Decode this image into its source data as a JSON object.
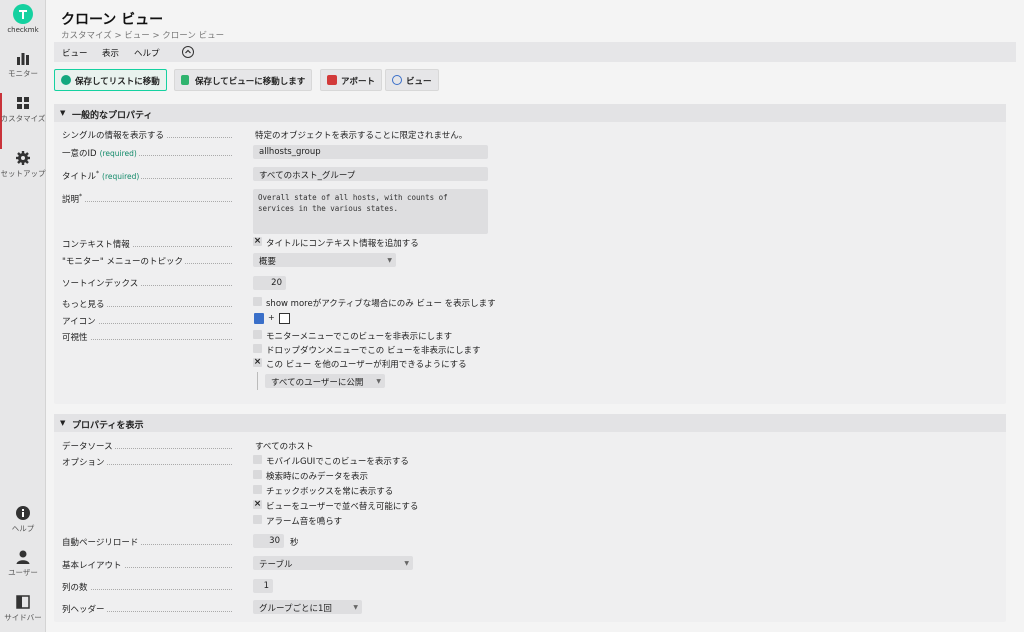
{
  "sidebar": {
    "brand": "checkmk",
    "items": [
      {
        "label": "モニター",
        "icon": "bar-chart-icon"
      },
      {
        "label": "カスタマイズ",
        "icon": "grid-icon"
      },
      {
        "label": "セットアップ",
        "icon": "gear-icon"
      }
    ],
    "bottom_items": [
      {
        "label": "ヘルプ",
        "icon": "info-icon"
      },
      {
        "label": "ユーザー",
        "icon": "user-icon"
      },
      {
        "label": "サイドバー",
        "icon": "sidebar-icon"
      }
    ]
  },
  "header": {
    "title": "クローン ビュー",
    "breadcrumb": "カスタマイズ > ビュー > クローン ビュー"
  },
  "menubar": {
    "items": [
      "ビュー",
      "表示",
      "ヘルプ"
    ]
  },
  "toolbar": {
    "save_list": "保存してリストに移動",
    "save_view": "保存してビューに移動します",
    "abort": "アボート",
    "view": "ビュー"
  },
  "general": {
    "heading": "一般的なプロパティ",
    "single_info_label": "シングルの情報を表示する",
    "single_info_value": "特定のオブジェクトを表示することに限定されません。",
    "id_label": "一意のID",
    "required": "(required)",
    "id_value": "allhosts_group",
    "title_label": "タイトル",
    "title_value": "すべてのホスト_グループ",
    "desc_label": "説明",
    "desc_value": "Overall state of all hosts, with counts of services in the various states.",
    "context_label": "コンテキスト情報",
    "context_cb": "タイトルにコンテキスト情報を追加する",
    "topic_label": "\"モニター\" メニューのトピック",
    "topic_value": "概要",
    "sort_label": "ソートインデックス",
    "sort_value": "20",
    "more_label": "もっと見る",
    "more_cb": "show moreがアクティブな場合にのみ ビュー を表示します",
    "icon_label": "アイコン",
    "icon_plus": "+",
    "visibility_label": "可視性",
    "vis_cb1": "モニターメニューでこのビューを非表示にします",
    "vis_cb2": "ドロップダウンメニューでこの ビューを非表示にします",
    "vis_cb3": "この ビュー を他のユーザーが利用できるようにする",
    "publish_value": "すべてのユーザーに公開"
  },
  "display": {
    "heading": "プロパティを表示",
    "datasource_label": "データソース",
    "datasource_value": "すべてのホスト",
    "options_label": "オプション",
    "opt1": "モバイルGUIでこのビューを表示する",
    "opt2": "検索時にのみデータを表示",
    "opt3": "チェックボックスを常に表示する",
    "opt4": "ビューをユーザーで並べ替え可能にする",
    "opt5": "アラーム音を鳴らす",
    "reload_label": "自動ページリロード",
    "reload_value": "30",
    "reload_unit": "秒",
    "layout_label": "基本レイアウト",
    "layout_value": "テーブル",
    "cols_label": "列の数",
    "cols_value": "1",
    "colheader_label": "列ヘッダー",
    "colheader_value": "グループごとに1回"
  },
  "colors": {
    "brand": "#15d1a0",
    "accent": "#c9333a"
  }
}
